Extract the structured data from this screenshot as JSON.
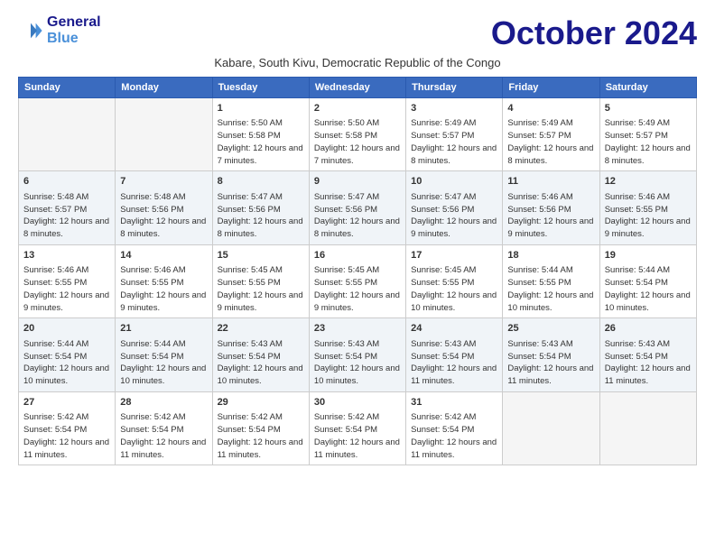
{
  "logo": {
    "line1": "General",
    "line2": "Blue",
    "icon": "▶"
  },
  "title": "October 2024",
  "subtitle": "Kabare, South Kivu, Democratic Republic of the Congo",
  "days_of_week": [
    "Sunday",
    "Monday",
    "Tuesday",
    "Wednesday",
    "Thursday",
    "Friday",
    "Saturday"
  ],
  "weeks": [
    [
      {
        "day": null,
        "info": null
      },
      {
        "day": null,
        "info": null
      },
      {
        "day": "1",
        "info": "Sunrise: 5:50 AM\nSunset: 5:58 PM\nDaylight: 12 hours and 7 minutes."
      },
      {
        "day": "2",
        "info": "Sunrise: 5:50 AM\nSunset: 5:58 PM\nDaylight: 12 hours and 7 minutes."
      },
      {
        "day": "3",
        "info": "Sunrise: 5:49 AM\nSunset: 5:57 PM\nDaylight: 12 hours and 8 minutes."
      },
      {
        "day": "4",
        "info": "Sunrise: 5:49 AM\nSunset: 5:57 PM\nDaylight: 12 hours and 8 minutes."
      },
      {
        "day": "5",
        "info": "Sunrise: 5:49 AM\nSunset: 5:57 PM\nDaylight: 12 hours and 8 minutes."
      }
    ],
    [
      {
        "day": "6",
        "info": "Sunrise: 5:48 AM\nSunset: 5:57 PM\nDaylight: 12 hours and 8 minutes."
      },
      {
        "day": "7",
        "info": "Sunrise: 5:48 AM\nSunset: 5:56 PM\nDaylight: 12 hours and 8 minutes."
      },
      {
        "day": "8",
        "info": "Sunrise: 5:47 AM\nSunset: 5:56 PM\nDaylight: 12 hours and 8 minutes."
      },
      {
        "day": "9",
        "info": "Sunrise: 5:47 AM\nSunset: 5:56 PM\nDaylight: 12 hours and 8 minutes."
      },
      {
        "day": "10",
        "info": "Sunrise: 5:47 AM\nSunset: 5:56 PM\nDaylight: 12 hours and 9 minutes."
      },
      {
        "day": "11",
        "info": "Sunrise: 5:46 AM\nSunset: 5:56 PM\nDaylight: 12 hours and 9 minutes."
      },
      {
        "day": "12",
        "info": "Sunrise: 5:46 AM\nSunset: 5:55 PM\nDaylight: 12 hours and 9 minutes."
      }
    ],
    [
      {
        "day": "13",
        "info": "Sunrise: 5:46 AM\nSunset: 5:55 PM\nDaylight: 12 hours and 9 minutes."
      },
      {
        "day": "14",
        "info": "Sunrise: 5:46 AM\nSunset: 5:55 PM\nDaylight: 12 hours and 9 minutes."
      },
      {
        "day": "15",
        "info": "Sunrise: 5:45 AM\nSunset: 5:55 PM\nDaylight: 12 hours and 9 minutes."
      },
      {
        "day": "16",
        "info": "Sunrise: 5:45 AM\nSunset: 5:55 PM\nDaylight: 12 hours and 9 minutes."
      },
      {
        "day": "17",
        "info": "Sunrise: 5:45 AM\nSunset: 5:55 PM\nDaylight: 12 hours and 10 minutes."
      },
      {
        "day": "18",
        "info": "Sunrise: 5:44 AM\nSunset: 5:55 PM\nDaylight: 12 hours and 10 minutes."
      },
      {
        "day": "19",
        "info": "Sunrise: 5:44 AM\nSunset: 5:54 PM\nDaylight: 12 hours and 10 minutes."
      }
    ],
    [
      {
        "day": "20",
        "info": "Sunrise: 5:44 AM\nSunset: 5:54 PM\nDaylight: 12 hours and 10 minutes."
      },
      {
        "day": "21",
        "info": "Sunrise: 5:44 AM\nSunset: 5:54 PM\nDaylight: 12 hours and 10 minutes."
      },
      {
        "day": "22",
        "info": "Sunrise: 5:43 AM\nSunset: 5:54 PM\nDaylight: 12 hours and 10 minutes."
      },
      {
        "day": "23",
        "info": "Sunrise: 5:43 AM\nSunset: 5:54 PM\nDaylight: 12 hours and 10 minutes."
      },
      {
        "day": "24",
        "info": "Sunrise: 5:43 AM\nSunset: 5:54 PM\nDaylight: 12 hours and 11 minutes."
      },
      {
        "day": "25",
        "info": "Sunrise: 5:43 AM\nSunset: 5:54 PM\nDaylight: 12 hours and 11 minutes."
      },
      {
        "day": "26",
        "info": "Sunrise: 5:43 AM\nSunset: 5:54 PM\nDaylight: 12 hours and 11 minutes."
      }
    ],
    [
      {
        "day": "27",
        "info": "Sunrise: 5:42 AM\nSunset: 5:54 PM\nDaylight: 12 hours and 11 minutes."
      },
      {
        "day": "28",
        "info": "Sunrise: 5:42 AM\nSunset: 5:54 PM\nDaylight: 12 hours and 11 minutes."
      },
      {
        "day": "29",
        "info": "Sunrise: 5:42 AM\nSunset: 5:54 PM\nDaylight: 12 hours and 11 minutes."
      },
      {
        "day": "30",
        "info": "Sunrise: 5:42 AM\nSunset: 5:54 PM\nDaylight: 12 hours and 11 minutes."
      },
      {
        "day": "31",
        "info": "Sunrise: 5:42 AM\nSunset: 5:54 PM\nDaylight: 12 hours and 11 minutes."
      },
      {
        "day": null,
        "info": null
      },
      {
        "day": null,
        "info": null
      }
    ]
  ]
}
